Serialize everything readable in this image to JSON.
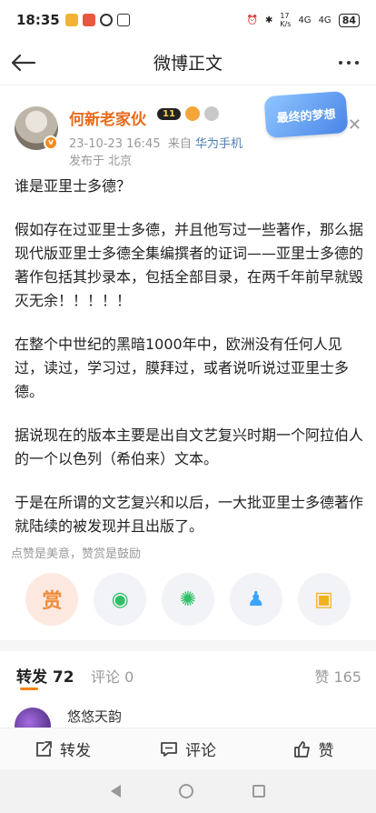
{
  "status_bar": {
    "time": "18:35",
    "net_speed": "17\nK/s",
    "signal_1": "4G",
    "signal_2": "4G",
    "battery": "84"
  },
  "nav": {
    "title": "微博正文"
  },
  "post": {
    "author": "何新老家伙",
    "vip_level": "11",
    "timestamp": "23-10-23 16:45",
    "source_prefix": "来自",
    "source": "华为手机",
    "location": "发布于 北京",
    "sticker_text": "最终的梦想",
    "paragraphs": [
      "谁是亚里士多德？",
      "假如存在过亚里士多德，并且他写过一些著作，那么据现代版亚里士多德全集编撰者的证词——亚里士多德的著作包括其抄录本，包括全部目录，在两千年前早就毁灭无余！！！！！",
      "在整个中世纪的黑暗1000年中，欧洲没有任何人见过，读过，学习过，膜拜过，或者说听说过亚里士多德。",
      "据说现在的版本主要是出自文艺复兴时期一个阿拉伯人的一个以色列（希伯来）文本。",
      "于是在所谓的文艺复兴和以后，一大批亚里士多德著作就陆续的被发现并且出版了。"
    ]
  },
  "reward": {
    "tip": "点赞是美意，赞赏是鼓励",
    "reward_label": "赏"
  },
  "tabs": {
    "repost": "转发 72",
    "comment": "评论 0",
    "like": "赞 165"
  },
  "repost_list": [
    {
      "name": "悠悠天韵"
    }
  ],
  "bottom_actions": {
    "repost": "转发",
    "comment": "评论",
    "like": "赞"
  },
  "colors": {
    "accent": "#ff8200",
    "author": "#e86a1c",
    "source_link": "#4f7fb3"
  }
}
